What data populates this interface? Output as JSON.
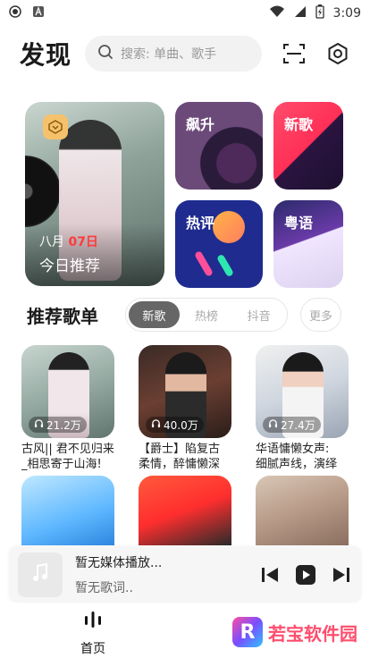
{
  "status_bar": {
    "time": "3:09"
  },
  "header": {
    "title": "发现",
    "search_placeholder": "搜索: 单曲、歌手"
  },
  "featured": {
    "month": "八月",
    "day": "07日",
    "title": "今日推荐"
  },
  "tiles": [
    {
      "label": "飙升"
    },
    {
      "label": "新歌"
    },
    {
      "label": "热评"
    },
    {
      "label": "粤语"
    }
  ],
  "section": {
    "title": "推荐歌单",
    "tabs": [
      "新歌",
      "热榜",
      "抖音"
    ],
    "active_tab": "新歌",
    "more": "更多"
  },
  "playlists": [
    {
      "count": "21.2万",
      "line1": "古风|| 君不见归来",
      "line2": "_相思寄于山海!"
    },
    {
      "count": "40.0万",
      "line1": "【爵士】陷复古",
      "line2": "柔情，醉慵懒深"
    },
    {
      "count": "27.4万",
      "line1": "华语慵懒女声:",
      "line2": "细腻声线，演绎"
    }
  ],
  "player": {
    "title": "暂无媒体播放...",
    "lyric": "暂无歌词.."
  },
  "nav": {
    "home": "首页"
  },
  "watermark": {
    "brand": "若宝软件园"
  },
  "colors": {
    "accent": "#ff3b3b",
    "active_tab": "#666666"
  }
}
